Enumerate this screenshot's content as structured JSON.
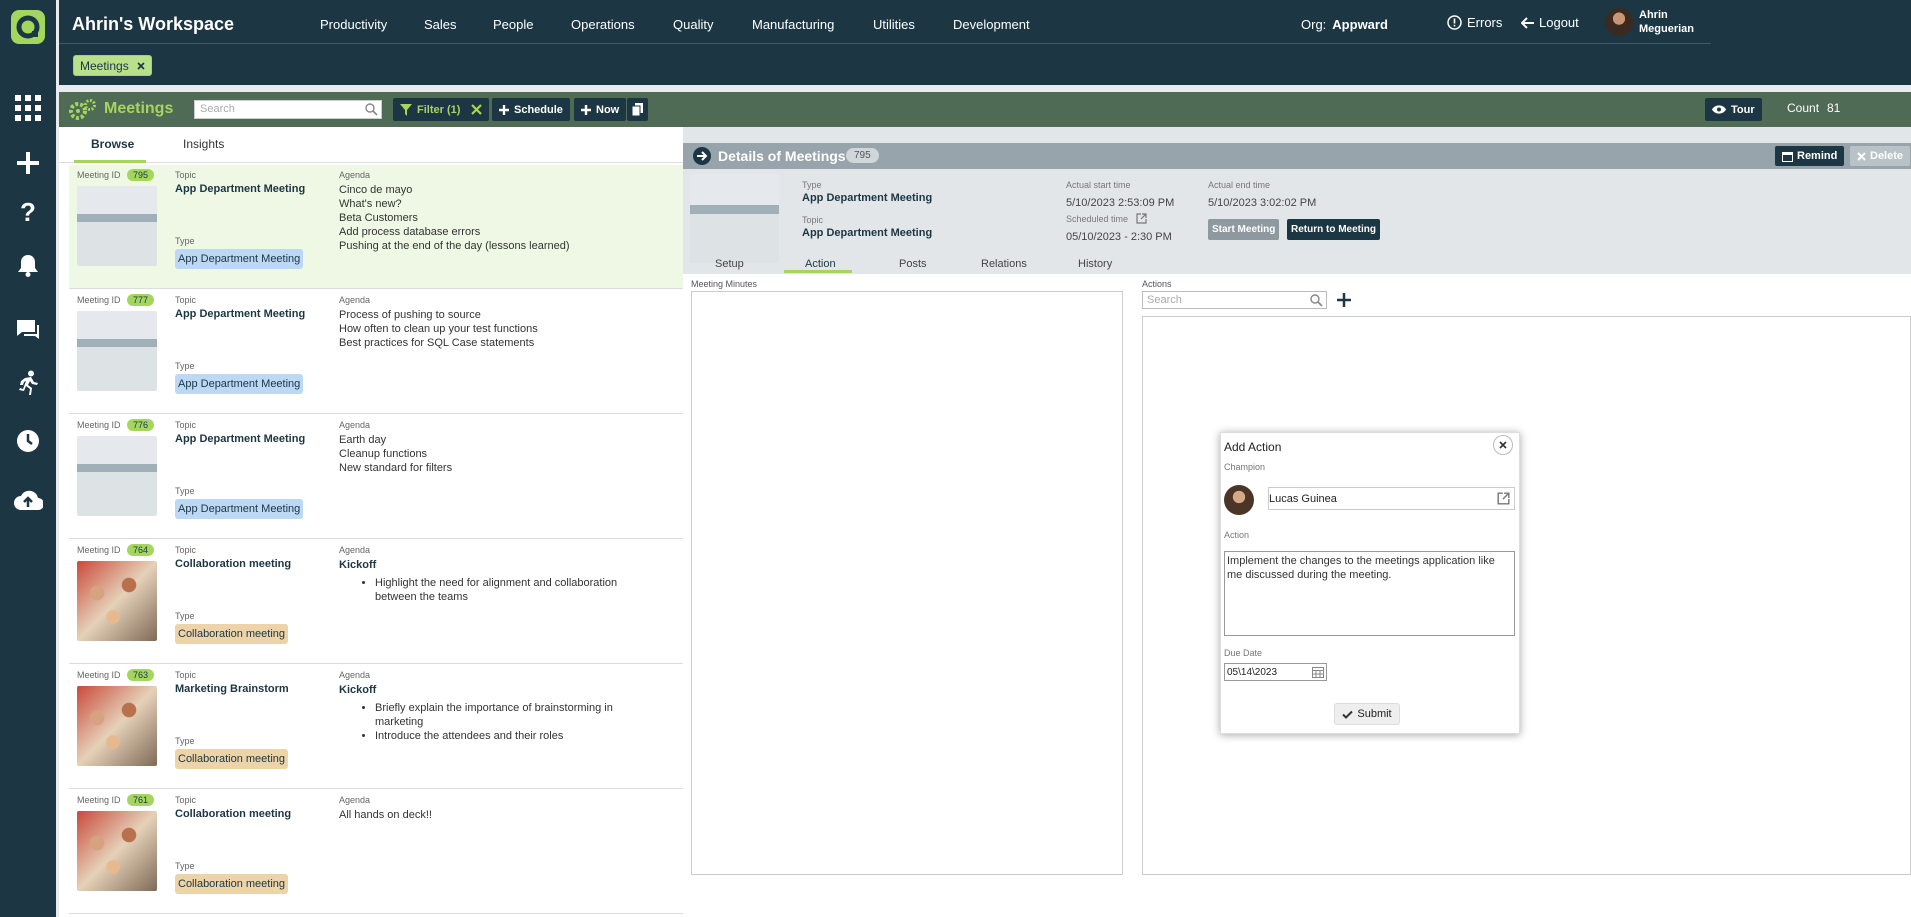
{
  "app": {
    "workspace": "Ahrin's Workspace",
    "nav": [
      "Productivity",
      "Sales",
      "People",
      "Operations",
      "Quality",
      "Manufacturing",
      "Utilities",
      "Development"
    ],
    "org_label": "Org:",
    "org_value": "Appward",
    "errors": "Errors",
    "logout": "Logout",
    "user": "Ahrin Meguerian",
    "brand_color": "#1c3643",
    "accent": "#a4d65e"
  },
  "filter_chip": "Meetings",
  "toolbar": {
    "title": "Meetings",
    "search_placeholder": "Search",
    "filter": "Filter (1)",
    "schedule": "Schedule",
    "now": "Now",
    "tour": "Tour",
    "count_label": "Count",
    "count_value": "81"
  },
  "browse": {
    "tabs": [
      "Browse",
      "Insights"
    ],
    "labels": {
      "id": "Meeting ID",
      "topic": "Topic",
      "type": "Type",
      "agenda": "Agenda"
    },
    "cards": [
      {
        "id": "795",
        "topic": "App Department Meeting",
        "type": "App Department Meeting",
        "agenda": [
          "Cinco de mayo",
          "What's new?",
          "Beta Customers",
          "Add process database errors",
          "Pushing at the end of the day (lessons learned)"
        ]
      },
      {
        "id": "777",
        "topic": "App Department Meeting",
        "type": "App Department Meeting",
        "agenda": [
          "Process of pushing to source",
          "How often to clean up your test functions",
          "Best practices for SQL Case statements"
        ]
      },
      {
        "id": "776",
        "topic": "App Department Meeting",
        "type": "App Department Meeting",
        "agenda": [
          "Earth day",
          "Cleanup functions",
          "New standard for filters"
        ]
      },
      {
        "id": "764",
        "topic": "Collaboration meeting",
        "type": "Collaboration meeting",
        "agenda_head": "Kickoff",
        "bullets": [
          "Highlight the need for alignment and collaboration between the teams"
        ]
      },
      {
        "id": "763",
        "topic": "Marketing Brainstorm",
        "type": "Collaboration meeting",
        "agenda_head": "Kickoff",
        "bullets": [
          "Briefly explain the importance of brainstorming in marketing",
          "Introduce the attendees and their roles"
        ]
      },
      {
        "id": "761",
        "topic": "Collaboration meeting",
        "type": "Collaboration meeting",
        "agenda": [
          "All hands on deck!!"
        ]
      }
    ]
  },
  "detail": {
    "title": "Details of Meetings",
    "count": "795",
    "remind": "Remind",
    "delete": "Delete",
    "type_label": "Type",
    "type": "App Department Meeting",
    "topic_label": "Topic",
    "topic": "App Department Meeting",
    "start_label": "Actual start time",
    "start": "5/10/2023 2:53:09 PM",
    "sched_label": "Scheduled time",
    "sched": "05/10/2023 - 2:30 PM",
    "end_label": "Actual end time",
    "end": "5/10/2023 3:02:02 PM",
    "start_btn": "Start Meeting",
    "return_btn": "Return to Meeting",
    "tabs": [
      "Setup",
      "Action",
      "Posts",
      "Relations",
      "History"
    ],
    "minutes_label": "Meeting Minutes",
    "actions_label": "Actions",
    "actions_placeholder": "Search"
  },
  "modal": {
    "title": "Add Action",
    "champion_label": "Champion",
    "champion": "Lucas Guinea",
    "action_label": "Action",
    "action_text": "Implement the changes to the meetings application like me discussed during the meeting.",
    "due_label": "Due Date",
    "due": "05\\14\\2023",
    "submit": "Submit"
  }
}
